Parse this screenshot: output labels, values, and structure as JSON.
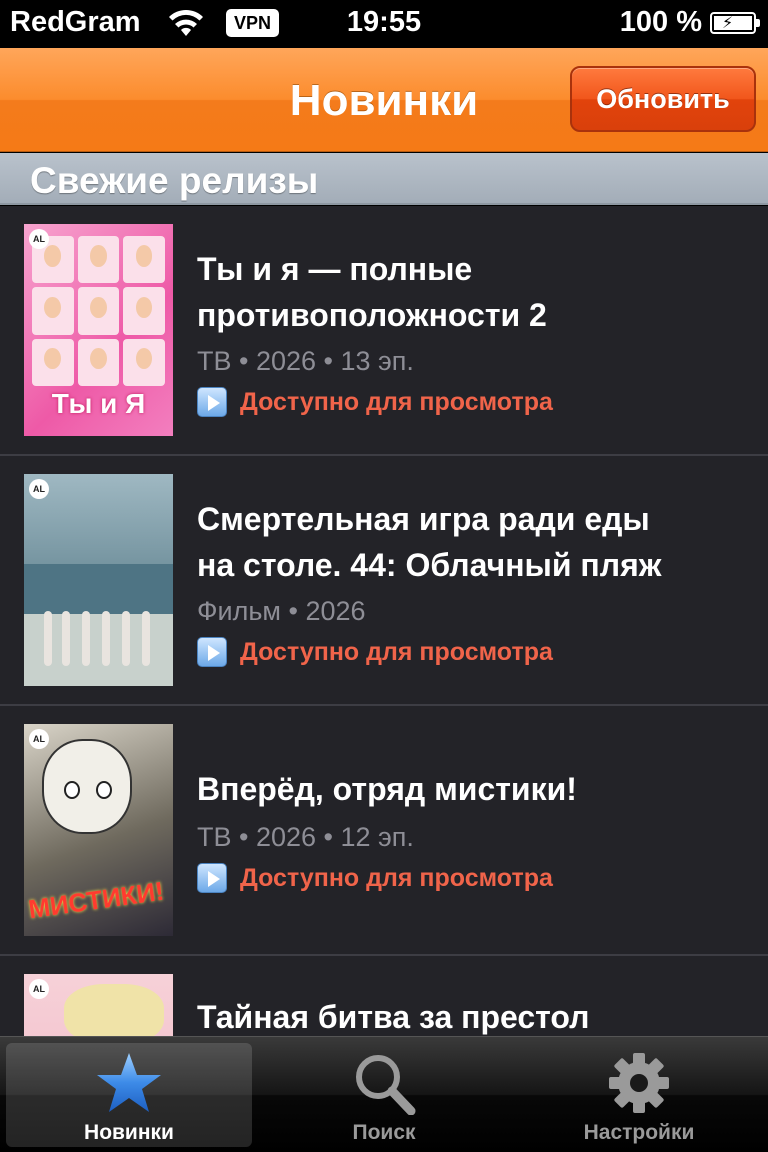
{
  "status_bar": {
    "carrier": "RedGram",
    "vpn": "VPN",
    "time": "19:55",
    "battery": "100 %"
  },
  "nav": {
    "title": "Новинки",
    "refresh_label": "Обновить"
  },
  "section": {
    "title": "Свежие релизы"
  },
  "items": [
    {
      "title_line1": "Ты и я — полные",
      "title_line2": "противоположности 2",
      "meta": "ТВ • 2026 • 13 эп.",
      "status": "Доступно для просмотра",
      "poster_text": "Ты и Я"
    },
    {
      "title_line1": "Смертельная игра ради еды",
      "title_line2": "на столе. 44: Облачный пляж",
      "meta": "Фильм • 2026",
      "status": "Доступно для просмотра"
    },
    {
      "title_line1": "Вперёд, отряд мистики!",
      "meta": "ТВ • 2026 • 12 эп.",
      "status": "Доступно для просмотра",
      "poster_text": "МИСТИКИ!"
    },
    {
      "title_line1": "Тайная битва за престол"
    }
  ],
  "tabs": [
    {
      "label": "Новинки",
      "icon": "star-icon",
      "active": true
    },
    {
      "label": "Поиск",
      "icon": "search-icon",
      "active": false
    },
    {
      "label": "Настройки",
      "icon": "gear-icon",
      "active": false
    }
  ],
  "colors": {
    "nav_orange": "#f57a16",
    "status_red": "#f0644a",
    "list_bg": "#232328",
    "active_tab_blue": "#3d8be8"
  }
}
